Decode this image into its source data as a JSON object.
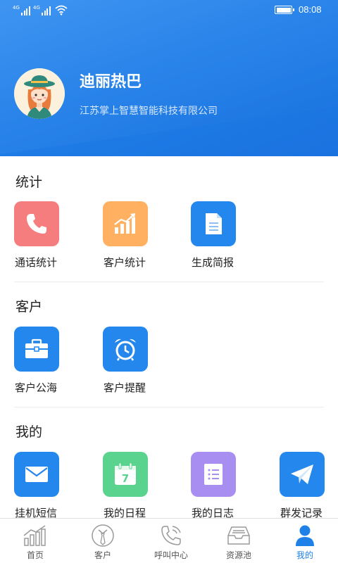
{
  "status_bar": {
    "signal1_label": "4G",
    "signal2_label": "4G",
    "time": "08:08"
  },
  "profile": {
    "name": "迪丽热巴",
    "company": "江苏掌上智慧智能科技有限公司"
  },
  "sections": {
    "stats": {
      "title": "统计",
      "items": [
        {
          "label": "通话统计",
          "icon": "phone-icon",
          "color": "#f57d7d"
        },
        {
          "label": "客户统计",
          "icon": "chart-icon",
          "color": "#ffb061"
        },
        {
          "label": "生成简报",
          "icon": "document-icon",
          "color": "#2487ed"
        }
      ]
    },
    "customer": {
      "title": "客户",
      "items": [
        {
          "label": "客户公海",
          "icon": "briefcase-icon",
          "color": "#2487ed"
        },
        {
          "label": "客户提醒",
          "icon": "alarm-clock-icon",
          "color": "#2487ed"
        }
      ]
    },
    "mine": {
      "title": "我的",
      "items": [
        {
          "label": "挂机短信",
          "icon": "envelope-icon",
          "color": "#2487ed"
        },
        {
          "label": "我的日程",
          "icon": "calendar-icon",
          "color": "#5ad38f",
          "calendar_day": "7"
        },
        {
          "label": "我的日志",
          "icon": "notebook-icon",
          "color": "#a98ef2"
        },
        {
          "label": "群发记录",
          "icon": "paper-plane-icon",
          "color": "#2487ed"
        }
      ]
    }
  },
  "tabbar": {
    "tabs": [
      {
        "label": "首页",
        "icon": "home-chart-icon",
        "active": false
      },
      {
        "label": "客户",
        "icon": "customer-tie-icon",
        "active": false
      },
      {
        "label": "呼叫中心",
        "icon": "call-center-icon",
        "active": false
      },
      {
        "label": "资源池",
        "icon": "inbox-tray-icon",
        "active": false
      },
      {
        "label": "我的",
        "icon": "user-icon",
        "active": true
      }
    ],
    "active_color": "#1f80e8"
  }
}
